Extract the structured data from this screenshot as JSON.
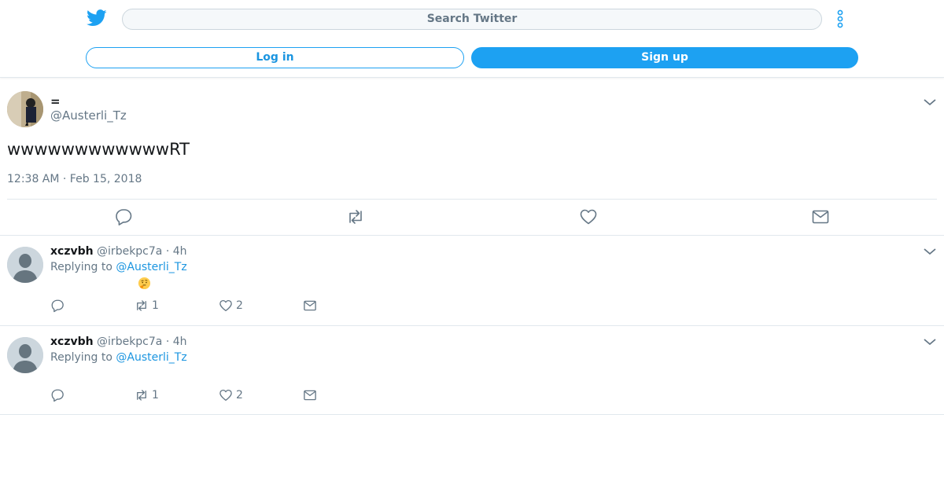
{
  "header": {
    "search_placeholder": "Search Twitter",
    "login_label": "Log in",
    "signup_label": "Sign up",
    "brand_color": "#1da1f2"
  },
  "main_tweet": {
    "author_name": "=",
    "author_handle": "@Austerli_Tz",
    "text": "wwwwwwwwwwwwRT",
    "timestamp": "12:38 AM · Feb 15, 2018",
    "actions": [
      "reply-icon",
      "retweet-icon",
      "like-icon",
      "share-icon"
    ]
  },
  "replies": [
    {
      "name": "xczvbh",
      "handle": "@irbekpc7a",
      "time": "4h",
      "replying_prefix": "Replying to",
      "replying_to": "@Austerli_Tz",
      "emoji": "🤔",
      "retweets": "1",
      "likes": "2"
    },
    {
      "name": "xczvbh",
      "handle": "@irbekpc7a",
      "time": "4h",
      "replying_prefix": "Replying to",
      "replying_to": "@Austerli_Tz",
      "retweets": "1",
      "likes": "2"
    }
  ]
}
